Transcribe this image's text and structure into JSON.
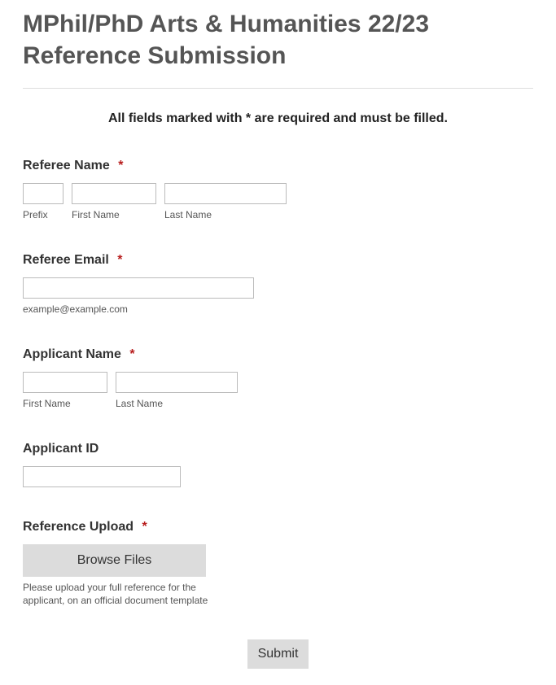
{
  "title": "MPhil/PhD Arts & Humanities 22/23 Reference Submission",
  "requiredNotice": "All fields marked with * are required and must be filled.",
  "requiredMark": "*",
  "refereeName": {
    "label": "Referee Name",
    "prefixSub": "Prefix",
    "firstSub": "First Name",
    "lastSub": "Last Name"
  },
  "refereeEmail": {
    "label": "Referee Email",
    "hint": "example@example.com"
  },
  "applicantName": {
    "label": "Applicant Name",
    "firstSub": "First Name",
    "lastSub": "Last Name"
  },
  "applicantId": {
    "label": "Applicant ID"
  },
  "referenceUpload": {
    "label": "Reference Upload",
    "button": "Browse Files",
    "hint": "Please upload your full reference for the applicant, on an official document template"
  },
  "submit": "Submit"
}
